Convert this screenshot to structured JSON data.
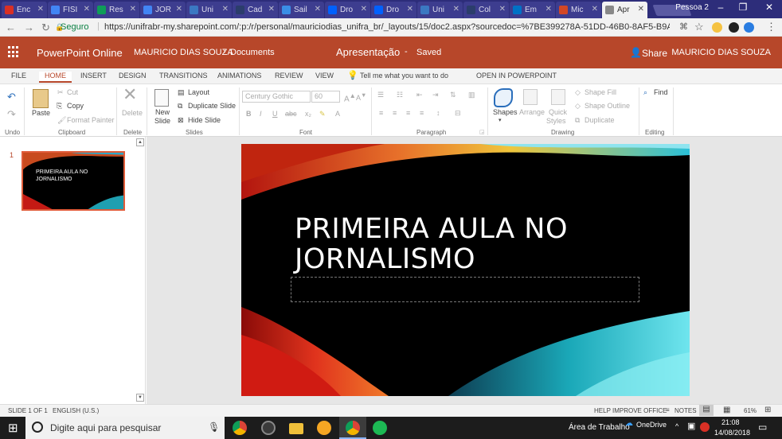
{
  "browser": {
    "tabs": [
      {
        "label": "Enc",
        "icon": "gmail-icon",
        "color": "#d93025"
      },
      {
        "label": "FISI",
        "icon": "docs-icon",
        "color": "#4285f4"
      },
      {
        "label": "Res",
        "icon": "drive-icon",
        "color": "#0f9d58"
      },
      {
        "label": "JOR",
        "icon": "docs-icon",
        "color": "#4285f4"
      },
      {
        "label": "Uni",
        "icon": "globe-icon",
        "color": "#3b78c2"
      },
      {
        "label": "Cad",
        "icon": "globe-icon",
        "color": "#2b3d6b"
      },
      {
        "label": "Sail",
        "icon": "sail-icon",
        "color": "#3a8ee6"
      },
      {
        "label": "Dro",
        "icon": "dropbox-icon",
        "color": "#0061fe"
      },
      {
        "label": "Dro",
        "icon": "dropbox-icon",
        "color": "#0061fe"
      },
      {
        "label": "Uni",
        "icon": "globe-icon",
        "color": "#3b78c2"
      },
      {
        "label": "Col",
        "icon": "globe-icon",
        "color": "#2b3d6b"
      },
      {
        "label": "Em",
        "icon": "outlook-icon",
        "color": "#0072c6"
      },
      {
        "label": "Mic",
        "icon": "powerpoint-icon",
        "color": "#d24726"
      },
      {
        "label": "Apr",
        "icon": "page-icon",
        "color": "#888888"
      }
    ],
    "profile": "Pessoa 2",
    "secure_label": "Seguro",
    "url": "https://unifrabr-my.sharepoint.com/:p:/r/personal/mauriciodias_unifra_br/_layouts/15/doc2.aspx?sourcedoc=%7BE399278A-51DD-46B0-8AF5-B9A95E95D61E..."
  },
  "app": {
    "name": "PowerPoint Online",
    "owner": "MAURICIO DIAS SOUZA",
    "breadcrumb_sep": "›",
    "folder": "Documents",
    "doc_title": "Apresentação",
    "dash": "-",
    "save_status": "Saved",
    "share_label": "Share",
    "user_name": "MAURICIO DIAS SOUZA",
    "accent": "#b7472a"
  },
  "ribbon_tabs": [
    "FILE",
    "HOME",
    "INSERT",
    "DESIGN",
    "TRANSITIONS",
    "ANIMATIONS",
    "REVIEW",
    "VIEW"
  ],
  "tell_me": "Tell me what you want to do",
  "open_in": "OPEN IN POWERPOINT",
  "ribbon": {
    "undo_group": "Undo",
    "paste": "Paste",
    "cut": "Cut",
    "copy": "Copy",
    "format_painter": "Format Painter",
    "clipboard_group": "Clipboard",
    "delete": "Delete",
    "delete_group": "Delete",
    "new_slide": "New",
    "new_slide2": "Slide",
    "layout": "Layout",
    "duplicate_slide": "Duplicate Slide",
    "hide_slide": "Hide Slide",
    "slides_group": "Slides",
    "font_name": "Century Gothic",
    "font_size": "60",
    "font_group": "Font",
    "paragraph_group": "Paragraph",
    "shapes": "Shapes",
    "arrange": "Arrange",
    "quick_styles": "Quick",
    "quick_styles2": "Styles",
    "shape_fill": "Shape Fill",
    "shape_outline": "Shape Outline",
    "duplicate": "Duplicate",
    "drawing_group": "Drawing",
    "find": "Find",
    "editing_group": "Editing"
  },
  "thumbnails": [
    {
      "number": "1",
      "title_line1": "PRIMEIRA AULA NO",
      "title_line2": "JORNALISMO"
    }
  ],
  "slide": {
    "title_line1": "PRIMEIRA AULA NO",
    "title_line2": "JORNALISMO"
  },
  "status": {
    "slide_count": "SLIDE 1 OF 1",
    "language": "ENGLISH (U.S.)",
    "help_improve": "HELP IMPROVE OFFICE",
    "notes": "NOTES",
    "zoom": "61%"
  },
  "taskbar": {
    "search_placeholder": "Digite aqui para pesquisar",
    "desktop": "Área de Trabalho",
    "onedrive": "OneDrive",
    "time": "21:08",
    "date": "14/08/2018"
  }
}
